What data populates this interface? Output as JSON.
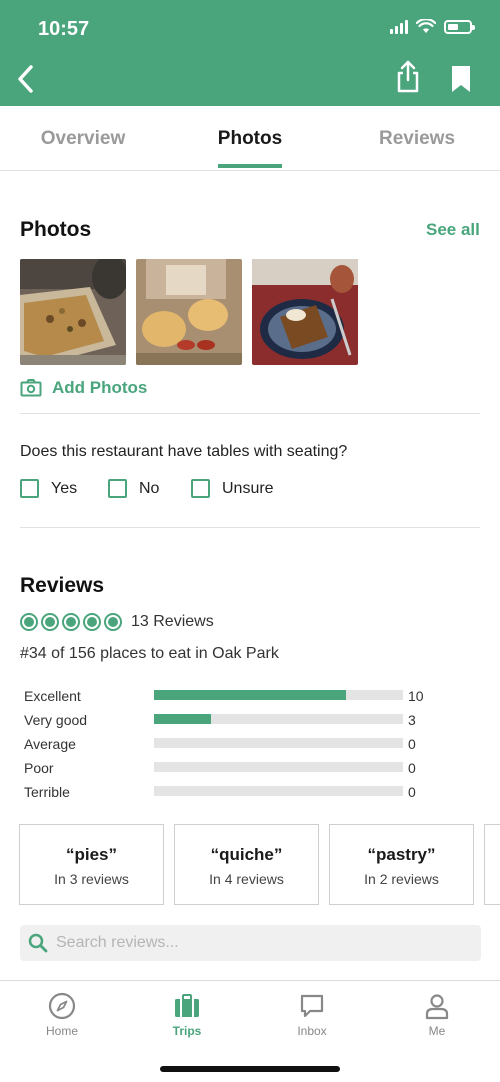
{
  "status_bar": {
    "time": "10:57"
  },
  "tabs": [
    {
      "label": "Overview",
      "active": false
    },
    {
      "label": "Photos",
      "active": true
    },
    {
      "label": "Reviews",
      "active": false
    }
  ],
  "photos_section": {
    "title": "Photos",
    "see_all": "See all",
    "add_photos": "Add Photos"
  },
  "seating_question": {
    "question": "Does this restaurant have tables with seating?",
    "options": [
      "Yes",
      "No",
      "Unsure"
    ]
  },
  "reviews_section": {
    "title": "Reviews",
    "bubble_rating": 5,
    "review_count": "13 Reviews",
    "rank": "#34 of 156 places to eat in Oak Park",
    "breakdown": [
      {
        "label": "Excellent",
        "count": "10",
        "fraction": 0.77
      },
      {
        "label": "Very good",
        "count": "3",
        "fraction": 0.23
      },
      {
        "label": "Average",
        "count": "0",
        "fraction": 0
      },
      {
        "label": "Poor",
        "count": "0",
        "fraction": 0
      },
      {
        "label": "Terrible",
        "count": "0",
        "fraction": 0
      }
    ],
    "mentions": [
      {
        "term": "“pies”",
        "sub": "In 3 reviews"
      },
      {
        "term": "“quiche”",
        "sub": "In 4 reviews"
      },
      {
        "term": "“pastry”",
        "sub": "In 2 reviews"
      }
    ],
    "search_placeholder": "Search reviews..."
  },
  "bottom_nav": [
    {
      "label": "Home",
      "icon": "compass-icon",
      "active": false
    },
    {
      "label": "Trips",
      "icon": "suitcase-icon",
      "active": true
    },
    {
      "label": "Inbox",
      "icon": "chat-bubble-icon",
      "active": false
    },
    {
      "label": "Me",
      "icon": "person-icon",
      "active": false
    }
  ],
  "colors": {
    "brand_green": "#4aa57c",
    "header_green": "#4aa57c"
  }
}
